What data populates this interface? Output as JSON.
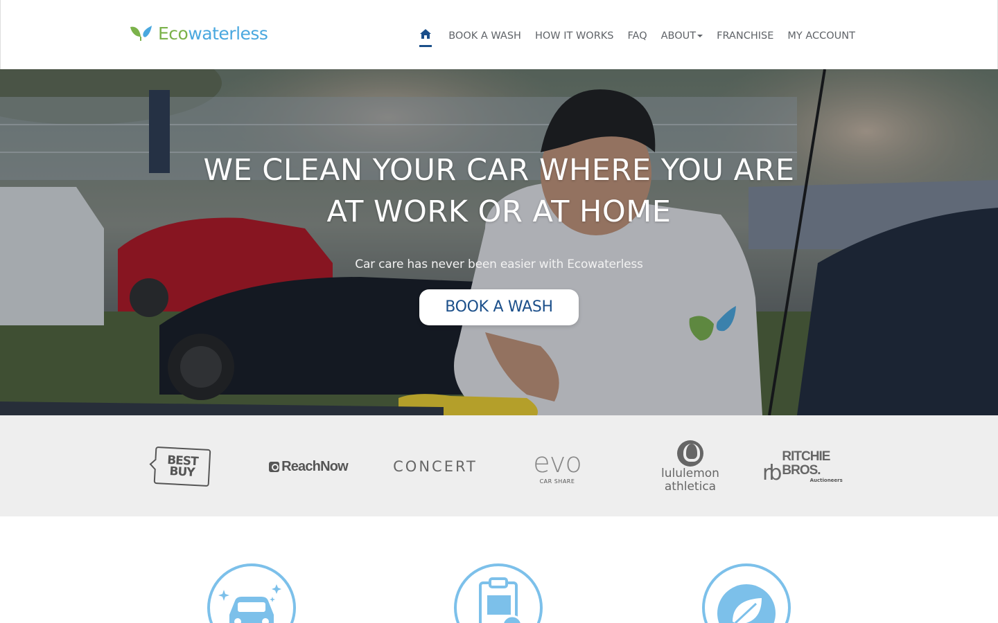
{
  "brand": {
    "name_part1": "Eco",
    "name_part2": "waterless",
    "colors": {
      "green": "#7bb24a",
      "blue": "#4aa8df",
      "navy": "#1b4f8a"
    }
  },
  "nav": {
    "home_icon": "home-icon",
    "items": [
      {
        "label": "BOOK A WASH"
      },
      {
        "label": "HOW IT WORKS"
      },
      {
        "label": "FAQ"
      },
      {
        "label": "ABOUT"
      },
      {
        "label": "FRANCHISE"
      },
      {
        "label": "MY ACCOUNT"
      }
    ]
  },
  "hero": {
    "title_line1": "WE CLEAN YOUR CAR WHERE YOU ARE",
    "title_line2": "AT WORK OR AT HOME",
    "subtitle": "Car care has never been easier with Ecowaterless",
    "cta_label": "BOOK A WASH"
  },
  "partners": {
    "bestbuy": {
      "line1": "BEST",
      "line2": "BUY"
    },
    "reachnow": "ReachNow",
    "concert": "CONCERT",
    "evo": {
      "main": "evo",
      "sub": "CAR SHARE"
    },
    "lululemon": {
      "line1": "lululemon",
      "line2": "athletica"
    },
    "ritchie": {
      "mark": "rb",
      "name": "RITCHIE BROS.",
      "sub": "Auctioneers"
    }
  },
  "features": {
    "icons": [
      "car-sparkle-icon",
      "clipboard-icon",
      "leaf-icon"
    ],
    "accent": "#7cc0ea"
  }
}
